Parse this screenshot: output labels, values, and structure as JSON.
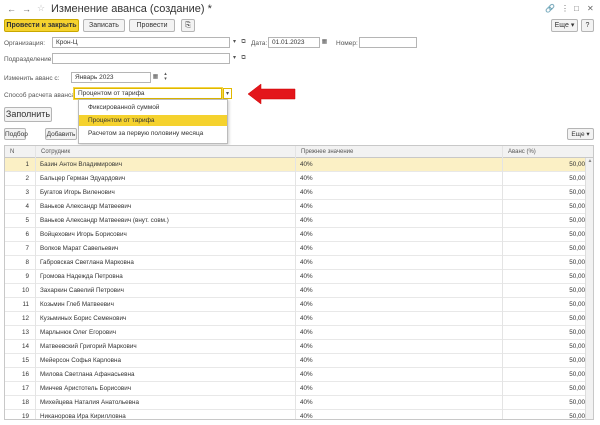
{
  "window": {
    "title": "Изменение аванса (создание) *",
    "more_glyph": "⋮",
    "restore_glyph": "□",
    "close_glyph": "✕"
  },
  "toolbar": {
    "post_close_label": "Провести и закрыть",
    "save_label": "Записать",
    "post_label": "Провести",
    "more_label": "Еще ▾",
    "help_label": "?"
  },
  "form": {
    "organization_label": "Организация:",
    "organization_value": "Крон-Ц",
    "date_label": "Дата:",
    "date_value": "01.01.2023",
    "number_label": "Номер:",
    "number_value": "",
    "department_label": "Подразделение:",
    "department_value": "",
    "change_from_label": "Изменить аванс с:",
    "change_from_value": "Январь 2023",
    "method_label": "Способ расчета аванса:",
    "method_value": "Процентом от тарифа",
    "fill_label": "Заполнить"
  },
  "method_options": [
    {
      "label": "Фиксированной суммой",
      "selected": false
    },
    {
      "label": "Процентом от тарифа",
      "selected": true
    },
    {
      "label": "Расчетом за первую половину месяца",
      "selected": false
    }
  ],
  "table_toolbar": {
    "select_label": "Подбор",
    "add_label": "Добавить",
    "more_label": "Еще ▾"
  },
  "table": {
    "columns": [
      "N",
      "Сотрудник",
      "Прежнее значение",
      "Аванс (%)"
    ],
    "rows": [
      {
        "n": "1",
        "employee": "Базин Антон Владимирович",
        "previous": "40%",
        "advance": "50,00"
      },
      {
        "n": "2",
        "employee": "Бальцер Герман Эдуардович",
        "previous": "40%",
        "advance": "50,00"
      },
      {
        "n": "3",
        "employee": "Бугатов Игорь Виленович",
        "previous": "40%",
        "advance": "50,00"
      },
      {
        "n": "4",
        "employee": "Ваньков Александр Матвеевич",
        "previous": "40%",
        "advance": "50,00"
      },
      {
        "n": "5",
        "employee": "Ваньков Александр Матвеевич (внут. совм.)",
        "previous": "40%",
        "advance": "50,00"
      },
      {
        "n": "6",
        "employee": "Войцехович Игорь Борисович",
        "previous": "40%",
        "advance": "50,00"
      },
      {
        "n": "7",
        "employee": "Волков Марат Савельевич",
        "previous": "40%",
        "advance": "50,00"
      },
      {
        "n": "8",
        "employee": "Габровская Светлана Марковна",
        "previous": "40%",
        "advance": "50,00"
      },
      {
        "n": "9",
        "employee": "Громова Надежда Петровна",
        "previous": "40%",
        "advance": "50,00"
      },
      {
        "n": "10",
        "employee": "Захаркин Савелий Петрович",
        "previous": "40%",
        "advance": "50,00"
      },
      {
        "n": "11",
        "employee": "Козьмин Глеб Матвеевич",
        "previous": "40%",
        "advance": "50,00"
      },
      {
        "n": "12",
        "employee": "Кузьминых Борис Семенович",
        "previous": "40%",
        "advance": "50,00"
      },
      {
        "n": "13",
        "employee": "Марлынюк Олег Егорович",
        "previous": "40%",
        "advance": "50,00"
      },
      {
        "n": "14",
        "employee": "Матвеевский Григорий Маркович",
        "previous": "40%",
        "advance": "50,00"
      },
      {
        "n": "15",
        "employee": "Мейерсон Софья Карловна",
        "previous": "40%",
        "advance": "50,00"
      },
      {
        "n": "16",
        "employee": "Милова Светлана Афанасьевна",
        "previous": "40%",
        "advance": "50,00"
      },
      {
        "n": "17",
        "employee": "Минчев Аристотель Борисович",
        "previous": "40%",
        "advance": "50,00"
      },
      {
        "n": "18",
        "employee": "Михейцева Наталия Анатольевна",
        "previous": "40%",
        "advance": "50,00"
      },
      {
        "n": "19",
        "employee": "Никанорова Ира Кирилловна",
        "previous": "40%",
        "advance": "50,00"
      }
    ]
  },
  "colors": {
    "accent": "#f5d22e",
    "active_row": "#fbf0c5",
    "arrow": "#e3161b"
  },
  "icons": [
    "back-icon",
    "forward-icon",
    "star-icon",
    "link-icon",
    "calendar-icon",
    "open-icon",
    "dropdown-icon",
    "spin-icon",
    "annotation-arrow-icon"
  ]
}
